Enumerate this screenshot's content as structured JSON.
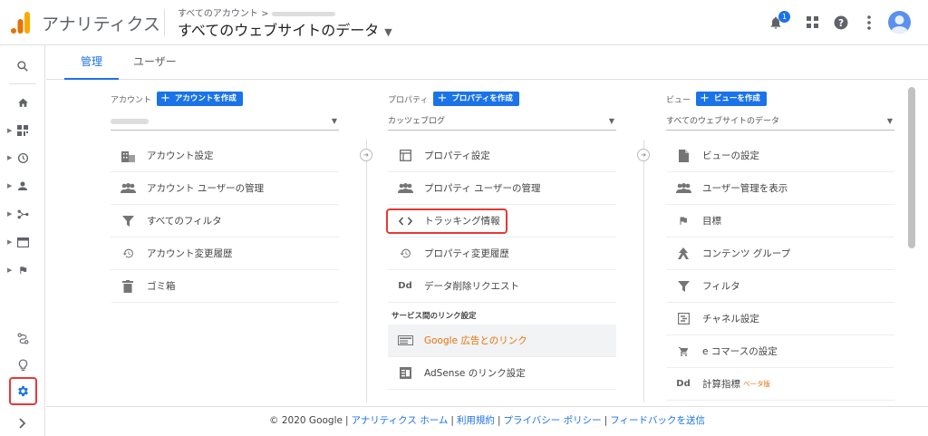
{
  "header": {
    "app_title": "アナリティクス",
    "breadcrumb": "すべてのアカウント >",
    "property_title": "すべてのウェブサイトのデータ",
    "notification_count": "1"
  },
  "tabs": {
    "admin": "管理",
    "user": "ユーザー"
  },
  "account": {
    "label": "アカウント",
    "create": "アカウントを作成",
    "items": [
      "アカウント設定",
      "アカウント ユーザーの管理",
      "すべてのフィルタ",
      "アカウント変更履歴",
      "ゴミ箱"
    ]
  },
  "property": {
    "label": "プロパティ",
    "create": "プロパティを作成",
    "selected": "カッツェブログ",
    "items": [
      "プロパティ設定",
      "プロパティ ユーザーの管理",
      "トラッキング情報",
      "プロパティ変更履歴",
      "データ削除リクエスト"
    ],
    "service_heading": "サービス間のリンク設定",
    "links": [
      "Google 広告とのリンク",
      "AdSense のリンク設定"
    ]
  },
  "view": {
    "label": "ビュー",
    "create": "ビューを作成",
    "selected": "すべてのウェブサイトのデータ",
    "items": [
      "ビューの設定",
      "ユーザー管理を表示",
      "目標",
      "コンテンツ グループ",
      "フィルタ",
      "チャネル設定",
      "e コマースの設定",
      "計算指標"
    ],
    "beta": "ベータ版"
  },
  "footer": {
    "copyright": "© 2020 Google",
    "links": [
      "アナリティクス ホーム",
      "利用規約",
      "プライバシー ポリシー",
      "フィードバックを送信"
    ]
  },
  "colors": {
    "accent": "#1a73e8",
    "highlight": "#e53935",
    "orange": "#e8710a"
  }
}
